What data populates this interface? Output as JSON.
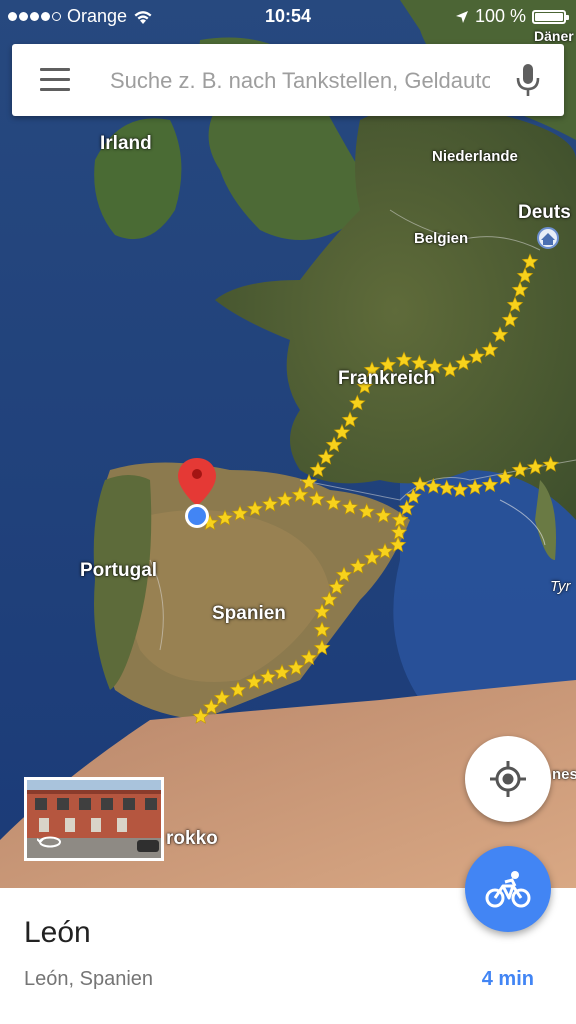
{
  "status_bar": {
    "carrier": "Orange",
    "time": "10:54",
    "battery_percent": "100 %"
  },
  "search": {
    "placeholder": "Suche z. B. nach Tankstellen, Geldautomaten"
  },
  "map": {
    "labels": {
      "irland": "Irland",
      "niederlande": "Niederlande",
      "belgien": "Belgien",
      "deutschland": "Deuts",
      "daenemark": "Däner",
      "frankreich": "Frankreich",
      "portugal": "Portugal",
      "spanien": "Spanien",
      "marokko": "rokko",
      "tyrrhenian": "Tyr",
      "tunesien": "nesi"
    },
    "colors": {
      "ocean": "#2a4f8f",
      "route_star": "#f7d21c",
      "pin": "#e53935",
      "location_dot": "#4285f4"
    }
  },
  "place": {
    "title": "León",
    "subtitle": "León, Spanien",
    "travel_time": "4 min"
  },
  "icons": {
    "menu": "menu-icon",
    "mic": "microphone-icon",
    "locate": "my-location-icon",
    "directions": "bicycle-icon",
    "streetview_rotate": "rotate-360-icon"
  }
}
